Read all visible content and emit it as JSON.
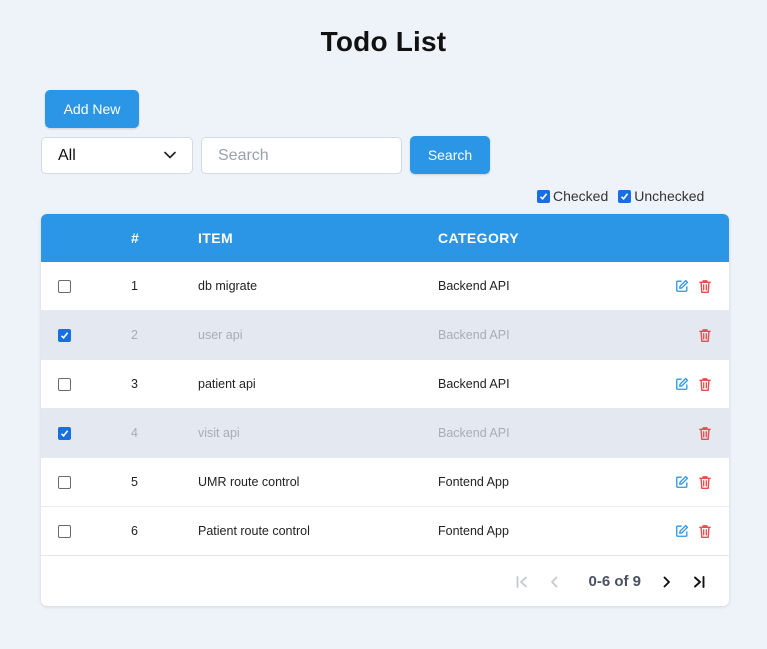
{
  "page": {
    "title": "Todo List"
  },
  "toolbar": {
    "add_label": "Add New",
    "filter_value": "All",
    "search_placeholder": "Search",
    "search_label": "Search"
  },
  "filters": {
    "checked_label": "Checked",
    "unchecked_label": "Unchecked",
    "checked_on": true,
    "unchecked_on": true
  },
  "table": {
    "headers": {
      "index": "#",
      "item": "ITEM",
      "category": "CATEGORY"
    },
    "rows": [
      {
        "index": "1",
        "item": "db migrate",
        "category": "Backend API",
        "checked": false
      },
      {
        "index": "2",
        "item": "user api",
        "category": "Backend API",
        "checked": true
      },
      {
        "index": "3",
        "item": "patient api",
        "category": "Backend API",
        "checked": false
      },
      {
        "index": "4",
        "item": "visit api",
        "category": "Backend API",
        "checked": true
      },
      {
        "index": "5",
        "item": "UMR route control",
        "category": "Fontend App",
        "checked": false
      },
      {
        "index": "6",
        "item": "Patient route control",
        "category": "Fontend App",
        "checked": false
      }
    ]
  },
  "pagination": {
    "range": "0-6 of 9"
  },
  "colors": {
    "accent": "#2b95e6",
    "background": "#eef2f9",
    "edit_icon": "#2b95e6",
    "delete_icon": "#e84d4d",
    "done_row": "#e4e8f0"
  },
  "icons": {
    "edit": "edit-icon",
    "delete": "trash-icon",
    "dropdown": "chevron-down-icon",
    "first": "first-page-icon",
    "prev": "prev-page-icon",
    "next": "next-page-icon",
    "last": "last-page-icon"
  }
}
